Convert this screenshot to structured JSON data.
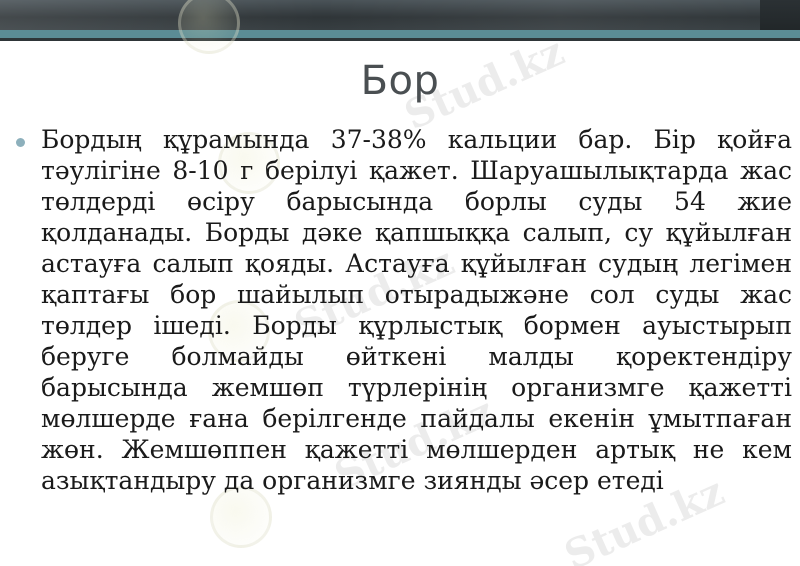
{
  "slide": {
    "title": "Бор",
    "paragraph": "Бордың құрамында 37-38% кальции бар. Бір қойға тәулігіне 8-10 г берілуі қажет. Шаруашылықтарда жас төлдерді өсіру барысында борлы суды 54 жие қолданады. Борды дәке қапшыққа салып, су құйылған астауға салып қояды. Астауға құйылған судың легімен қаптағы бор шайылып отырадыжәне сол суды жас төлдер ішеді. Борды құрлыстық бормен ауыстырып беруге болмайды өйткені малды қоректендіру барысында жемшөп түрлерінің организмге қажетті мөлшерде ғана берілгенде пайдалы екенін ұмытпаған жөн. Жемшөппен қажетті мөлшерден артық не кем азықтандыру да организмге зиянды әсер етеді"
  },
  "watermark": {
    "text": "Stud.kz"
  },
  "colors": {
    "header_dark": "#2f3538",
    "header_teal": "#5b8c95",
    "bullet": "#8db0bc",
    "title_text": "#4a4f52"
  }
}
